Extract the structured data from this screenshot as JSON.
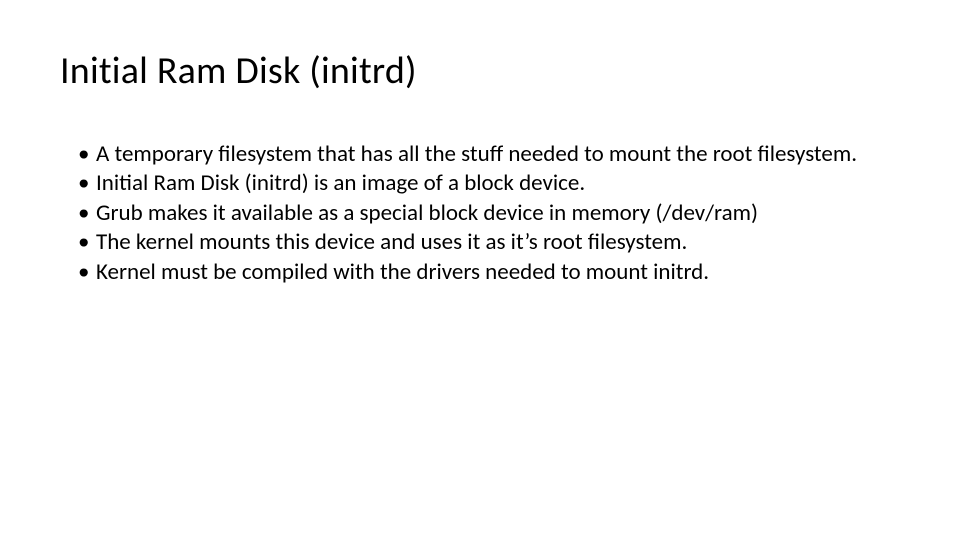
{
  "title": "Initial Ram Disk (initrd)",
  "bullets": [
    "A temporary filesystem that has all the stuff needed to mount the root filesystem.",
    "Initial Ram Disk (initrd) is an image of a block device.",
    "Grub makes it available as a special block device in memory (/dev/ram)",
    "The kernel mounts this device and uses it as it’s root filesystem.",
    "Kernel must be compiled with the drivers needed to mount initrd."
  ]
}
